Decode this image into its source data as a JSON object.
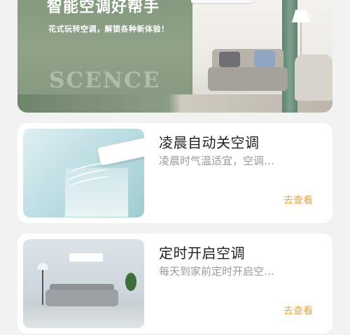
{
  "banner": {
    "title": "智能空调好帮手",
    "subtitle": "花式玩转空调，解锁各种新体验！",
    "watermark": "SCENCE"
  },
  "scenes": [
    {
      "title": "凌晨自动关空调",
      "description": "凌晨时气温适宜，空调…",
      "action_label": "去查看"
    },
    {
      "title": "定时开启空调",
      "description": "每天到家前定时开启空…",
      "action_label": "去查看"
    }
  ],
  "colors": {
    "accent": "#f5a623",
    "banner_green": "#7d9478",
    "background": "#f2f2f2",
    "card": "#ffffff",
    "title_text": "#222222",
    "description_text": "#9a9a9a"
  }
}
